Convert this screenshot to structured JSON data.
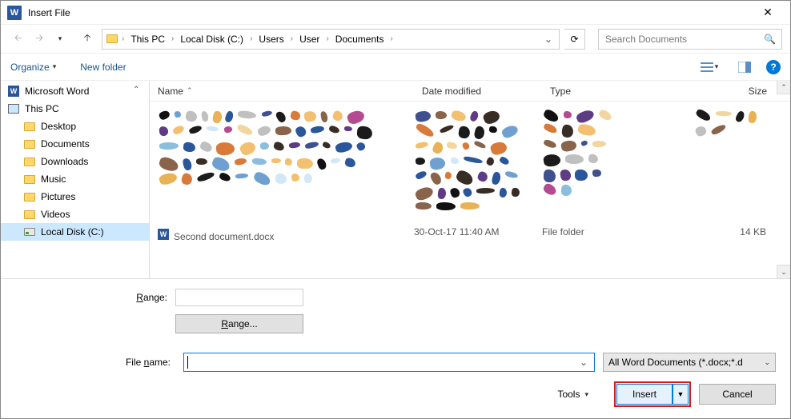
{
  "title": "Insert File",
  "nav": {
    "back_enabled": false,
    "forward_enabled": false,
    "up_enabled": true
  },
  "breadcrumb": [
    "This PC",
    "Local Disk (C:)",
    "Users",
    "User",
    "Documents"
  ],
  "search_placeholder": "Search Documents",
  "toolbar": {
    "organize": "Organize",
    "new_folder": "New folder"
  },
  "columns": {
    "name": "Name",
    "date": "Date modified",
    "type": "Type",
    "size": "Size"
  },
  "tree": [
    {
      "label": "Microsoft Word",
      "icon": "word",
      "indent": 0
    },
    {
      "label": "This PC",
      "icon": "pc",
      "indent": 0
    },
    {
      "label": "Desktop",
      "icon": "folder",
      "indent": 1
    },
    {
      "label": "Documents",
      "icon": "folder",
      "indent": 1
    },
    {
      "label": "Downloads",
      "icon": "folder",
      "indent": 1
    },
    {
      "label": "Music",
      "icon": "folder",
      "indent": 1
    },
    {
      "label": "Pictures",
      "icon": "folder",
      "indent": 1
    },
    {
      "label": "Videos",
      "icon": "folder",
      "indent": 1
    },
    {
      "label": "Local Disk (C:)",
      "icon": "drive",
      "indent": 1,
      "selected": true
    }
  ],
  "file_row": {
    "name": "Second document.docx",
    "date": "30-Oct-17 11:40 AM",
    "type": "File folder",
    "size": "14 KB"
  },
  "range": {
    "label": "Range:",
    "button": "Range..."
  },
  "filename": {
    "label": "File name:",
    "value": ""
  },
  "filter": "All Word Documents (*.docx;*.d",
  "tools": "Tools",
  "buttons": {
    "insert": "Insert",
    "cancel": "Cancel"
  },
  "blob_colors": [
    "#2b579a",
    "#e8b255",
    "#d77a3a",
    "#1b1b1b",
    "#b44a90",
    "#8bbedd",
    "#f1d79f",
    "#5e3c84",
    "#c0c0c0",
    "#372d24",
    "#89634a",
    "#d3e8f6",
    "#f2c070",
    "#404f8e",
    "#111",
    "#6fa0d0"
  ]
}
